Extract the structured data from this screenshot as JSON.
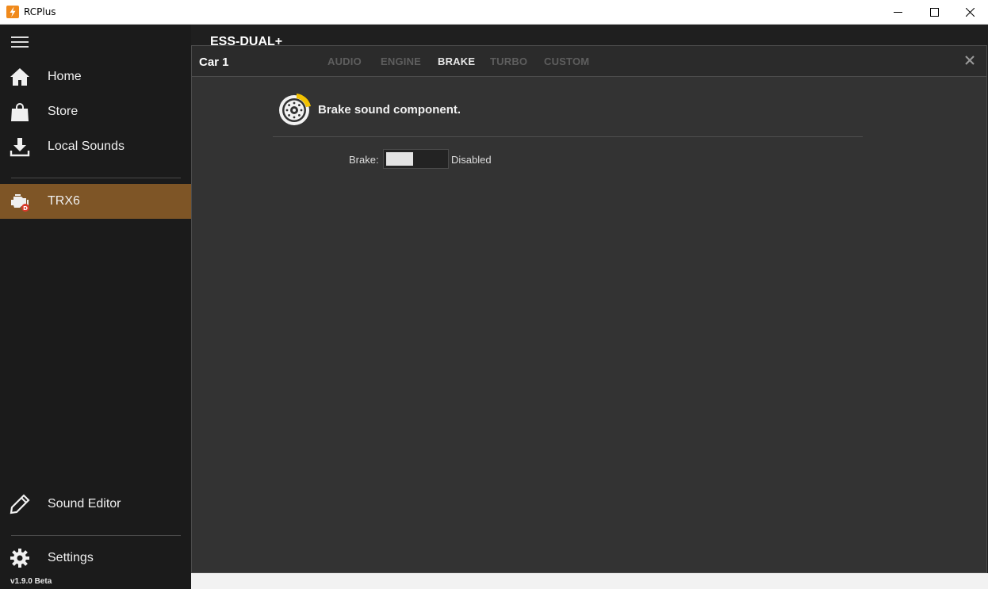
{
  "window": {
    "title": "RCPlus",
    "icon": "lightning-bolt-icon",
    "accent": "#f08a1c"
  },
  "sidebar": {
    "items": [
      {
        "label": "Home",
        "icon": "home-icon"
      },
      {
        "label": "Store",
        "icon": "shopping-bag-icon"
      },
      {
        "label": "Local Sounds",
        "icon": "download-icon"
      },
      {
        "label": "TRX6",
        "icon": "engine-icon",
        "active": true
      },
      {
        "label": "Sound Editor",
        "icon": "pencil-icon"
      },
      {
        "label": "Settings",
        "icon": "gear-icon"
      }
    ],
    "version": "v1.9.0 Beta",
    "active_color": "#7e5526"
  },
  "main": {
    "device_title": "ESS-DUAL+",
    "panel": {
      "title": "Car 1",
      "tabs": [
        {
          "label": "AUDIO",
          "active": false
        },
        {
          "label": "ENGINE",
          "active": false
        },
        {
          "label": "BRAKE",
          "active": true
        },
        {
          "label": "TURBO",
          "active": false
        },
        {
          "label": "CUSTOM",
          "active": false
        }
      ],
      "section": {
        "title": "Brake sound component.",
        "icon": "brake-disc-icon",
        "icon_accent": "#f2c200"
      },
      "field": {
        "label": "Brake:",
        "status": "Disabled",
        "enabled": false
      }
    }
  }
}
